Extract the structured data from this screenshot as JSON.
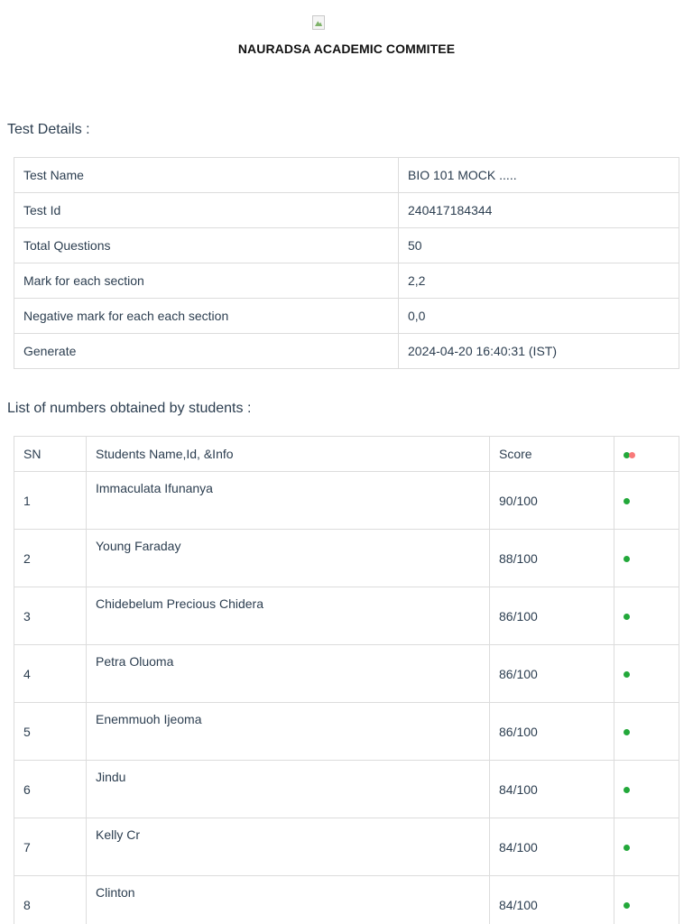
{
  "header": {
    "org_title": "NAURADSA ACADEMIC COMMITEE"
  },
  "test_details": {
    "title": "Test Details :",
    "rows": [
      {
        "label": "Test Name",
        "value": "BIO 101 MOCK ....."
      },
      {
        "label": "Test Id",
        "value": "240417184344"
      },
      {
        "label": "Total Questions",
        "value": "50"
      },
      {
        "label": "Mark for each section",
        "value": "2,2"
      },
      {
        "label": "Negative mark for each each section",
        "value": "0,0"
      },
      {
        "label": "Generate",
        "value": "2024-04-20 16:40:31 (IST)"
      }
    ]
  },
  "results": {
    "title": "List of numbers obtained by students :",
    "headers": {
      "sn": "SN",
      "name": "Students Name,Id, &Info",
      "score": "Score"
    },
    "status_colors": {
      "pass": "#22a83a",
      "fail": "#f87a7a"
    },
    "rows": [
      {
        "sn": "1",
        "name": "Immaculata Ifunanya",
        "score": "90/100",
        "status": "pass"
      },
      {
        "sn": "2",
        "name": "Young Faraday",
        "score": "88/100",
        "status": "pass"
      },
      {
        "sn": "3",
        "name": "Chidebelum Precious Chidera",
        "score": "86/100",
        "status": "pass"
      },
      {
        "sn": "4",
        "name": "Petra Oluoma",
        "score": "86/100",
        "status": "pass"
      },
      {
        "sn": "5",
        "name": "Enemmuoh Ijeoma",
        "score": "86/100",
        "status": "pass"
      },
      {
        "sn": "6",
        "name": "Jindu",
        "score": "84/100",
        "status": "pass"
      },
      {
        "sn": "7",
        "name": "Kelly Cr",
        "score": "84/100",
        "status": "pass"
      },
      {
        "sn": "8",
        "name": "Clinton",
        "score": "84/100",
        "status": "pass"
      }
    ]
  }
}
